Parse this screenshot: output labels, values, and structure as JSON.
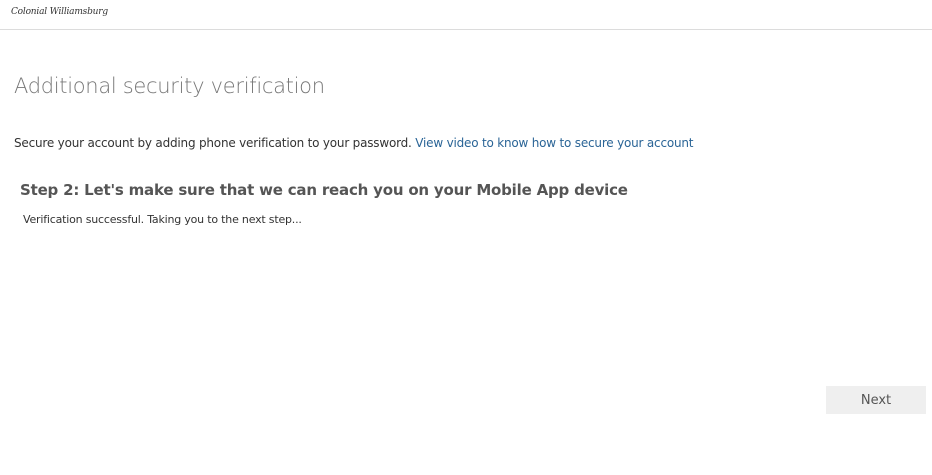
{
  "header": {
    "logo_text": "Colonial Williamsburg"
  },
  "main": {
    "title": "Additional security verification",
    "intro_text": "Secure your account by adding phone verification to your password. ",
    "intro_link": "View video to know how to secure your account",
    "step_title": "Step 2: Let's make sure that we can reach you on your Mobile App device",
    "status_text": "Verification successful. Taking you to the next step..."
  },
  "footer": {
    "next_label": "Next"
  },
  "colors": {
    "link": "#2a6496",
    "title": "#777777",
    "button_bg": "#efefef"
  }
}
